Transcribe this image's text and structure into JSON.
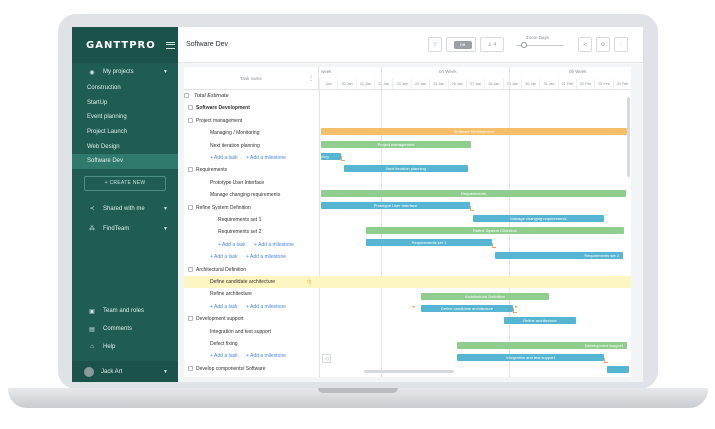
{
  "app": {
    "logo": "GANTTPRO",
    "project_title": "Software Dev"
  },
  "sidebar": {
    "my_projects": "My projects",
    "projects": [
      "Construction",
      "StartUp",
      "Event planning",
      "Project Launch",
      "Web Design",
      "Software Dev"
    ],
    "create_new": "+ CREATE NEW",
    "shared_with_me": "Shared with me",
    "find_team": "FindTeam",
    "team_and_roles": "Team and roles",
    "comments": "Comments",
    "help": "Help",
    "user": "Jack Art"
  },
  "toolbar": {
    "toggle_label": "Off",
    "people_count": "4",
    "zoom_label": "Zoom Days"
  },
  "grid": {
    "header": "Task name",
    "rows": [
      {
        "label": "Total Estimate",
        "kind": "total"
      },
      {
        "label": "Software Development",
        "kind": "bold"
      },
      {
        "label": "Project management",
        "kind": "group"
      },
      {
        "label": "Managing / Monitoring",
        "kind": "task"
      },
      {
        "label": "Next iteration planning",
        "kind": "task"
      },
      {
        "label": "+ Add a task",
        "label2": "+ Add a milestone",
        "kind": "add"
      },
      {
        "label": "Requirements",
        "kind": "group"
      },
      {
        "label": "Prototype User Interface",
        "kind": "task"
      },
      {
        "label": "Manage changing requirements",
        "kind": "task"
      },
      {
        "label": "Refine System Definition",
        "kind": "group"
      },
      {
        "label": "Requirements set 1",
        "kind": "subtask"
      },
      {
        "label": "Requirements set 2",
        "kind": "subtask"
      },
      {
        "label": "+ Add a task",
        "label2": "+ Add a milestone",
        "kind": "add2"
      },
      {
        "label": "+ Add a task",
        "label2": "+ Add a milestone",
        "kind": "add"
      },
      {
        "label": "Architectural Definition",
        "kind": "group"
      },
      {
        "label": "Define candidate architecture",
        "kind": "task",
        "highlight": true
      },
      {
        "label": "Refine architecture",
        "kind": "task"
      },
      {
        "label": "+ Add a task",
        "label2": "+ Add a milestone",
        "kind": "add"
      },
      {
        "label": "Development support",
        "kind": "group"
      },
      {
        "label": "Integration and test support",
        "kind": "task"
      },
      {
        "label": "Defect fixing",
        "kind": "task"
      },
      {
        "label": "+ Add a task",
        "label2": "+ Add a milestone",
        "kind": "add"
      },
      {
        "label": "Develop components/ Software",
        "kind": "group"
      }
    ]
  },
  "timeline": {
    "weeks": [
      "week",
      "04 Week",
      "05 Week"
    ],
    "days": [
      "Jan",
      "20 Jan",
      "21 Jan",
      "22 Jan",
      "23 Jan",
      "24 Jan",
      "25 Jan",
      "26 Jan",
      "27 Jan",
      "28 Jan",
      "29 Jan",
      "30 Jan",
      "31 Jan",
      "01 Feb",
      "02 Feb",
      "03 Feb",
      "04 Feb"
    ],
    "bars": {
      "software_development": "Software Development",
      "project_management": "Project management",
      "managing": "ning",
      "next_iteration": "Next iteration planning",
      "requirements": "Requirements",
      "prototype": "Prototype User Interface",
      "manage_changing": "Manage changing requirements",
      "refine_system": "Refine System Definition",
      "req_set1": "Requirements set 1",
      "req_set2": "Requirements set 2",
      "arch_def": "Architectural Definition",
      "define_candidate": "Define candidate architecture",
      "refine_arch": "Refine architecture",
      "dev_support": "Development support",
      "integration": "Integration and test support"
    }
  }
}
